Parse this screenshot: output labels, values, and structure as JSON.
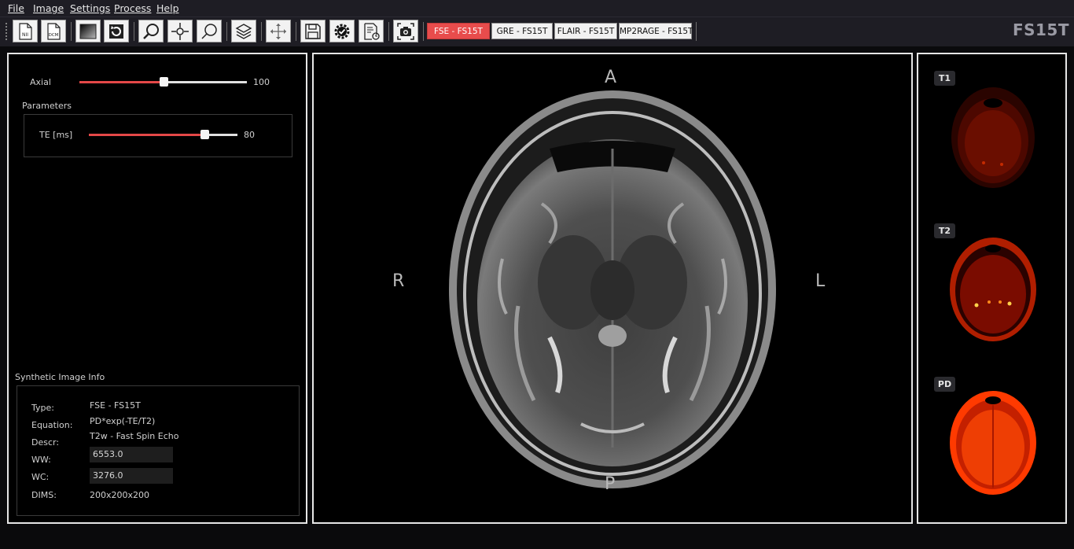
{
  "menu": {
    "file": "File",
    "image": "Image",
    "settings": "Settings",
    "process": "Process",
    "help": "Help"
  },
  "toolbar": {
    "icons": [
      "nifti-file-icon",
      "dicom-file-icon",
      "window-level-icon",
      "rotate-icon",
      "zoom-in-icon",
      "crosshair-icon",
      "zoom-out-icon",
      "layers-icon",
      "pan-move-icon",
      "save-icon",
      "settings-check-icon",
      "report-icon",
      "screenshot-camera-icon"
    ],
    "nii_label": "NII",
    "dcm_label": "DCM",
    "sequences": [
      "FSE - FS15T",
      "GRE - FS15T",
      "FLAIR - FS15T",
      "MP2RAGE - FS15T"
    ],
    "active_sequence": "FSE - FS15T"
  },
  "app_title": "FS15T",
  "controls": {
    "axial": {
      "label": "Axial",
      "value": "100",
      "fraction": 0.5
    },
    "parameters_title": "Parameters",
    "te": {
      "label": "TE [ms]",
      "value": "80",
      "fraction": 0.78
    }
  },
  "info": {
    "title": "Synthetic Image Info",
    "type_label": "Type:",
    "type_value": "FSE - FS15T",
    "equation_label": "Equation:",
    "equation_value": "PD*exp(-TE/T2)",
    "descr_label": "Descr:",
    "descr_value": "T2w - Fast Spin Echo",
    "ww_label": "WW:",
    "ww_value": "6553.0",
    "wc_label": "WC:",
    "wc_value": "3276.0",
    "dims_label": "DIMS:",
    "dims_value": "200x200x200"
  },
  "viewer": {
    "anterior": "A",
    "posterior": "P",
    "right": "R",
    "left": "L"
  },
  "maps": {
    "t1": "T1",
    "t2": "T2",
    "pd": "PD"
  },
  "colors": {
    "accent": "#e84c4c",
    "panel_border": "#e6e6e6",
    "background": "#000000"
  }
}
